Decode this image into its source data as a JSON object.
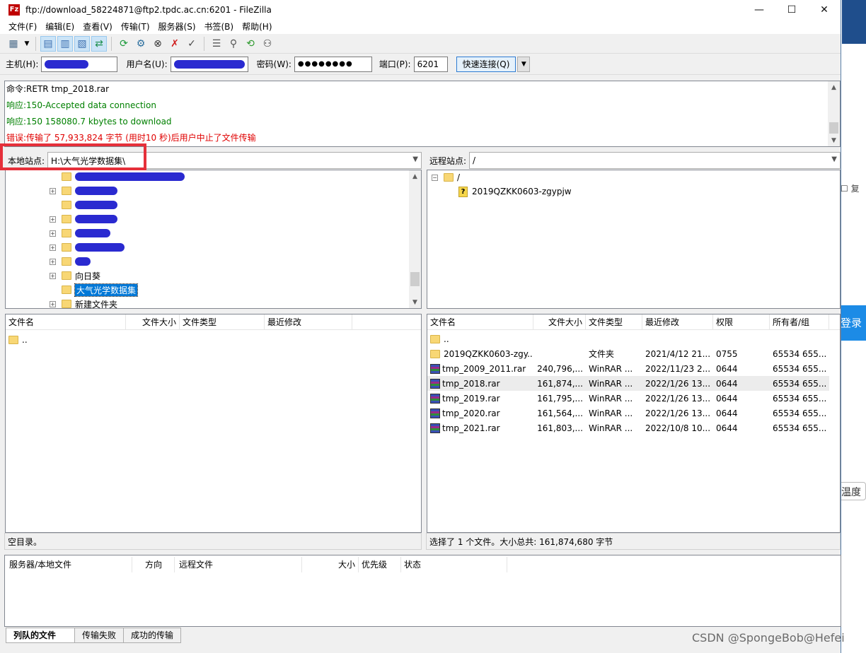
{
  "window": {
    "title": "ftp://download_58224871@ftp2.tpdc.ac.cn:6201 - FileZilla",
    "app_icon": "Fz",
    "minimize": "—",
    "maximize": "☐",
    "close": "✕"
  },
  "menu": [
    "文件(F)",
    "编辑(E)",
    "查看(V)",
    "传输(T)",
    "服务器(S)",
    "书签(B)",
    "帮助(H)"
  ],
  "toolbar": {
    "icons": [
      "site-manager-icon",
      "process-queue-icon",
      "toggle-log-icon",
      "toggle-local-tree-icon",
      "toggle-remote-tree-icon",
      "toggle-queue-icon",
      "refresh-icon",
      "filter-icon",
      "cancel-icon",
      "disconnect-icon",
      "reconnect-icon",
      "directory-compare-icon",
      "sync-browse-icon",
      "search-icon",
      "binoculars-icon"
    ]
  },
  "quickconnect": {
    "host_label": "主机(H):",
    "user_label": "用户名(U):",
    "pass_label": "密码(W):",
    "pass_value": "●●●●●●●●",
    "port_label": "端口(P):",
    "port_value": "6201",
    "button": "快速连接(Q)"
  },
  "log": [
    {
      "text": "命令:RETR tmp_2018.rar",
      "color": "#000000"
    },
    {
      "text": "响应:150-Accepted data connection",
      "color": "#008000"
    },
    {
      "text": "响应:150 158080.7 kbytes to download",
      "color": "#008000"
    },
    {
      "text": "错误:传输了 57,933,824 字节 (用时10 秒)后用户中止了文件传输",
      "color": "#e00000"
    }
  ],
  "local": {
    "site_label": "本地站点:",
    "path": "H:\\大气光学数据集\\",
    "tree": [
      {
        "label": "",
        "redacted": true,
        "expander": ""
      },
      {
        "label": "",
        "redacted": true,
        "expander": "+"
      },
      {
        "label": "",
        "redacted": true,
        "expander": ""
      },
      {
        "label": "",
        "redacted": true,
        "expander": "+"
      },
      {
        "label": "",
        "redacted": true,
        "expander": "+"
      },
      {
        "label": "",
        "redacted": true,
        "expander": "+"
      },
      {
        "label": "",
        "redacted": true,
        "expander": "+"
      },
      {
        "label": "向日葵",
        "redacted": false,
        "expander": "+"
      },
      {
        "label": "大气光学数据集",
        "redacted": false,
        "expander": "",
        "selected": true
      },
      {
        "label": "新建文件夹",
        "redacted": false,
        "expander": "+"
      }
    ],
    "columns": [
      "文件名",
      "文件大小",
      "文件类型",
      "最近修改"
    ],
    "files": [
      {
        "name": ".."
      }
    ],
    "status": "空目录。"
  },
  "remote": {
    "site_label": "远程站点:",
    "path": "/",
    "tree_root": "/",
    "tree_child": "2019QZKK0603-zgypjw",
    "columns": [
      "文件名",
      "文件大小",
      "文件类型",
      "最近修改",
      "权限",
      "所有者/组"
    ],
    "files": [
      {
        "name": "..",
        "size": "",
        "type": "",
        "modified": "",
        "perm": "",
        "owner": "",
        "icon": "folder"
      },
      {
        "name": "2019QZKK0603-zgy...",
        "size": "",
        "type": "文件夹",
        "modified": "2021/4/12 21...",
        "perm": "0755",
        "owner": "65534 655...",
        "icon": "folder"
      },
      {
        "name": "tmp_2009_2011.rar",
        "size": "240,796,...",
        "type": "WinRAR ...",
        "modified": "2022/11/23 2...",
        "perm": "0644",
        "owner": "65534 655...",
        "icon": "rar"
      },
      {
        "name": "tmp_2018.rar",
        "size": "161,874,...",
        "type": "WinRAR ...",
        "modified": "2022/1/26 13...",
        "perm": "0644",
        "owner": "65534 655...",
        "icon": "rar",
        "highlight": true
      },
      {
        "name": "tmp_2019.rar",
        "size": "161,795,...",
        "type": "WinRAR ...",
        "modified": "2022/1/26 13...",
        "perm": "0644",
        "owner": "65534 655...",
        "icon": "rar"
      },
      {
        "name": "tmp_2020.rar",
        "size": "161,564,...",
        "type": "WinRAR ...",
        "modified": "2022/1/26 13...",
        "perm": "0644",
        "owner": "65534 655...",
        "icon": "rar"
      },
      {
        "name": "tmp_2021.rar",
        "size": "161,803,...",
        "type": "WinRAR ...",
        "modified": "2022/10/8 10...",
        "perm": "0644",
        "owner": "65534 655...",
        "icon": "rar"
      }
    ],
    "status": "选择了 1 个文件。大小总共: 161,874,680 字节"
  },
  "queue": {
    "columns": [
      "服务器/本地文件",
      "方向",
      "远程文件",
      "大小",
      "优先级",
      "状态"
    ],
    "tabs": [
      "列队的文件",
      "传输失败",
      "成功的传输"
    ]
  },
  "background": {
    "copy_text": "复",
    "login_text": "登录",
    "degree_text": "温度"
  },
  "watermark": "CSDN @SpongeBob@Hefei"
}
